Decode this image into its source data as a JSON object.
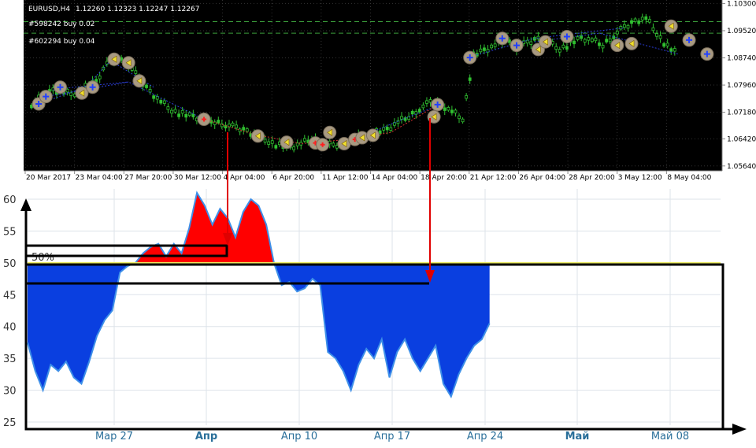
{
  "chart_data": [
    {
      "type": "line",
      "title": "EURUSD,H4",
      "ohlc_header": "1.12260 1.12323 1.12247 1.12267",
      "orders": [
        "#598242 buy 0.02",
        "#602294 buy 0.04"
      ],
      "y_ticks": [
        "1.10300",
        "1.09520",
        "1.08740",
        "1.07960",
        "1.07180",
        "1.06420",
        "1.05640"
      ],
      "x_ticks": [
        "20 Mar 2017",
        "23 Mar 04:00",
        "27 Mar 20:00",
        "30 Mar 12:00",
        "4 Apr 04:00",
        "6 Apr 20:00",
        "11 Apr 12:00",
        "14 Apr 04:00",
        "18 Apr 20:00",
        "21 Apr 12:00",
        "26 Apr 04:00",
        "28 Apr 20:00",
        "3 May 12:00",
        "8 May 04:00"
      ],
      "ylim": [
        1.055,
        1.104
      ],
      "series": [
        {
          "x": [
            0,
            3,
            6,
            9,
            12,
            15,
            18,
            21,
            24,
            27,
            30,
            33,
            36,
            39,
            42,
            45,
            48,
            51,
            54,
            57,
            60,
            63,
            66,
            69,
            72,
            75,
            78,
            81,
            84,
            87,
            90,
            93,
            96,
            99,
            102,
            105,
            108,
            111,
            114,
            117,
            120,
            123,
            126,
            129,
            132,
            135,
            138,
            141,
            144,
            147,
            150,
            153,
            156,
            159,
            162,
            165,
            168,
            171,
            174,
            177,
            180
          ],
          "y": [
            1.0742,
            1.0763,
            1.0782,
            1.0776,
            1.0772,
            1.079,
            1.0805,
            1.086,
            1.0872,
            1.0858,
            1.081,
            1.0778,
            1.075,
            1.0725,
            1.0712,
            1.0705,
            1.0698,
            1.069,
            1.0684,
            1.0672,
            1.0665,
            1.065,
            1.0635,
            1.0622,
            1.0616,
            1.0628,
            1.064,
            1.0632,
            1.062,
            1.0628,
            1.0645,
            1.065,
            1.066,
            1.0668,
            1.069,
            1.0705,
            1.073,
            1.0745,
            1.074,
            1.0722,
            1.07,
            1.088,
            1.0895,
            1.091,
            1.0925,
            1.0905,
            1.0915,
            1.093,
            1.0918,
            1.09,
            1.0915,
            1.093,
            1.0925,
            1.091,
            1.094,
            1.096,
            1.098,
            1.099,
            1.0945,
            1.0905,
            1.0885
          ]
        }
      ],
      "grid": true,
      "colors": {
        "background": "#000000",
        "candle": "#30c030",
        "level": "#3ca03c",
        "trail": "#2a3cd8",
        "text": "#ffffff"
      }
    },
    {
      "type": "area",
      "x_ticks": [
        "Мар 27",
        "Апр",
        "Апр 10",
        "Апр 17",
        "Апр 24",
        "Май",
        "Май 08"
      ],
      "y_ticks": [
        "60",
        "55",
        "50",
        "45",
        "40",
        "35",
        "30",
        "25"
      ],
      "ylim": [
        25,
        62
      ],
      "threshold": 50,
      "threshold_label": "50%",
      "x": [
        0,
        2,
        4,
        6,
        8,
        10,
        12,
        14,
        16,
        18,
        20,
        22,
        24,
        26,
        28,
        30,
        32,
        34,
        36,
        38,
        40,
        42,
        44,
        46,
        48,
        50,
        52,
        54,
        56,
        58,
        60,
        62,
        64,
        66,
        68,
        70,
        72,
        74,
        76,
        78,
        80,
        82,
        84,
        86,
        88,
        90,
        92,
        94,
        96,
        98,
        100,
        102,
        104,
        106,
        108,
        110,
        112,
        114,
        116,
        118,
        120,
        122,
        124,
        126,
        128,
        130,
        132,
        134,
        136,
        138,
        140,
        142,
        144,
        146,
        148,
        150,
        152,
        154,
        156,
        158,
        160,
        162,
        164,
        166,
        168,
        170,
        172,
        174,
        176,
        178,
        180
      ],
      "values": [
        37.5,
        33.0,
        30.0,
        34.0,
        33.0,
        34.5,
        32.0,
        31.0,
        34.5,
        38.5,
        41.0,
        42.5,
        48.5,
        49.5,
        50.0,
        51.5,
        52.5,
        53.0,
        51.0,
        53.0,
        51.5,
        55.5,
        61.0,
        59.0,
        56.0,
        58.5,
        57.0,
        54.0,
        58.0,
        60.0,
        59.0,
        56.0,
        50.0,
        46.5,
        47.0,
        45.5,
        46.0,
        47.5,
        46.5,
        36.0,
        35.0,
        33.0,
        30.0,
        34.0,
        36.5,
        35.0,
        38.0,
        32.0,
        36.0,
        38.0,
        35.0,
        33.0,
        35.0,
        37.0,
        31.0,
        29.0,
        32.5,
        35.0,
        37.0,
        38.0,
        40.5
      ],
      "colors": {
        "above": "#ff0000",
        "below": "#0a3fe0",
        "outline": "#3d8fe8",
        "threshold": "#e8e860",
        "box": "#000000",
        "arrow": "#e00000"
      }
    }
  ]
}
